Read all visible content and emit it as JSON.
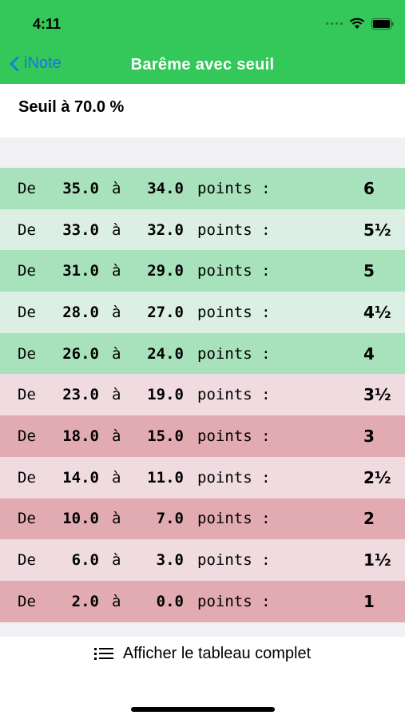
{
  "status_bar": {
    "time": "4:11",
    "icons": [
      "signal-icon",
      "wifi-icon",
      "battery-icon"
    ]
  },
  "nav": {
    "back_label": "iNote",
    "title": "Barême avec seuil",
    "accent_color": "#34c759",
    "back_color": "#1a73e8"
  },
  "threshold": {
    "text": "Seuil à 70.0 %"
  },
  "table": {
    "word_de": "De",
    "word_a": "à",
    "word_points": "points :",
    "rows": [
      {
        "from": "35.0",
        "to": "34.0",
        "grade": "6",
        "color": "#a8e2bd"
      },
      {
        "from": "33.0",
        "to": "32.0",
        "grade": "5½",
        "color": "#dcefe5"
      },
      {
        "from": "31.0",
        "to": "29.0",
        "grade": "5",
        "color": "#a8e2bd"
      },
      {
        "from": "28.0",
        "to": "27.0",
        "grade": "4½",
        "color": "#dcefe5"
      },
      {
        "from": "26.0",
        "to": "24.0",
        "grade": "4",
        "color": "#a8e2bd"
      },
      {
        "from": "23.0",
        "to": "19.0",
        "grade": "3½",
        "color": "#efdbe0"
      },
      {
        "from": "18.0",
        "to": "15.0",
        "grade": "3",
        "color": "#e2abb2"
      },
      {
        "from": "14.0",
        "to": "11.0",
        "grade": "2½",
        "color": "#efdbe0"
      },
      {
        "from": "10.0",
        "to": "7.0",
        "grade": "2",
        "color": "#e2abb2"
      },
      {
        "from": "6.0",
        "to": "3.0",
        "grade": "1½",
        "color": "#efdbe0"
      },
      {
        "from": "2.0",
        "to": "0.0",
        "grade": "1",
        "color": "#e2abb2"
      }
    ]
  },
  "footer": {
    "button_label": "Afficher le tableau complet",
    "icon": "list-icon"
  }
}
